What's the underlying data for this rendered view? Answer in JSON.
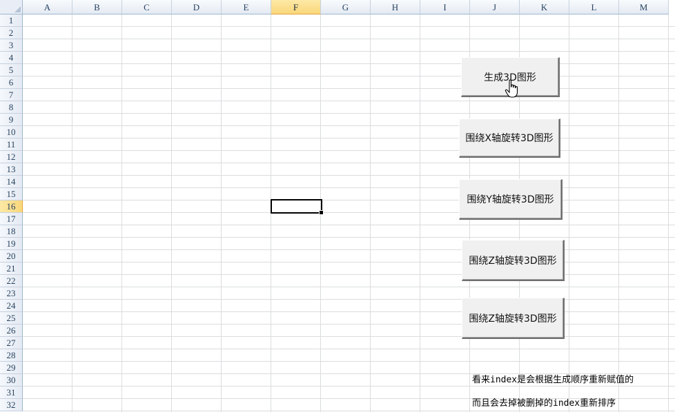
{
  "spreadsheet": {
    "columns": [
      "A",
      "B",
      "C",
      "D",
      "E",
      "F",
      "G",
      "H",
      "I",
      "J",
      "K",
      "L",
      "M"
    ],
    "active_column": "F",
    "rows": [
      "1",
      "2",
      "3",
      "4",
      "5",
      "6",
      "7",
      "8",
      "9",
      "10",
      "11",
      "12",
      "13",
      "14",
      "15",
      "16",
      "17",
      "18",
      "19",
      "20",
      "21",
      "22",
      "23",
      "24",
      "25",
      "26",
      "27",
      "28",
      "29",
      "30",
      "31",
      "32"
    ],
    "active_row": "16"
  },
  "buttons": {
    "generate_3d": "生成3D图形",
    "rotate_x": "围绕X轴旋转3D图形",
    "rotate_y": "围绕Y轴旋转3D图形",
    "rotate_z_1": "围绕Z轴旋转3D图形",
    "rotate_z_2": "围绕Z轴旋转3D图形"
  },
  "note": {
    "line1": "看来index是会根据生成顺序重新赋值的",
    "line2": "而且会去掉被删掉的index重新排序"
  },
  "cursor_icon": "hand-pointer-icon"
}
